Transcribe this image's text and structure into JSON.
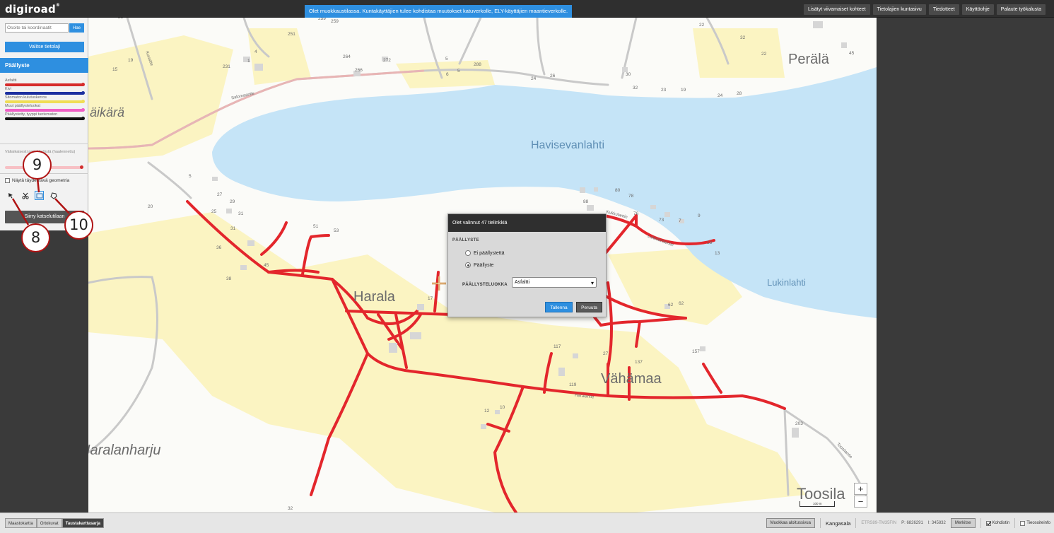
{
  "app": {
    "logo": "digiroad",
    "logo_mark": "®"
  },
  "notice": "Olet muokkaustilassa. Kuntakäyttäjien tulee kohdistaa muutokset katuverkolle, ELY-käyttäjien maantieverkolle.",
  "top_links": [
    "Lisätyt viivamaiset kohteet",
    "Tietolajien kuntasivu",
    "Tiedotteet",
    "Käyttöohje",
    "Palaute työkalusta"
  ],
  "sidebar": {
    "search_placeholder": "Osoite tai koordinaatit",
    "search_button": "Hae",
    "select_layer_button": "Valitse tietolaji",
    "layer_title": "Päällyste",
    "legend": [
      {
        "label": "Asfaltti",
        "color": "#d62b2b"
      },
      {
        "label": "Kivi",
        "color": "#1c2fa0"
      },
      {
        "label": "Sitomaton kulutuskerros",
        "color": "#f0dd55"
      },
      {
        "label": "Muut päällysteluokat",
        "color": "#ef5fc6"
      },
      {
        "label": "Päällystetty, tyyppi tuntematon",
        "color": "#111111"
      }
    ],
    "temporary_label": "Väliaikaisesti pois käytöstä (haalennettu)",
    "show_geometry_label": "Näytä täydentävä geometria",
    "view_mode_button": "Siirry katselutilaan"
  },
  "map_labels": {
    "perala": "Perälä",
    "havisevanlahti": "Havisevanlahti",
    "harala": "Harala",
    "lukinlahti": "Lukinlahti",
    "vahamaa": "Vähämaa",
    "haralanharju": "Haralanharju",
    "toosila": "Toosila",
    "aikara": "äikärä",
    "salomaantie": "Salomaantie",
    "kukkulantie": "Kukkulantie",
    "lukinlahdentie": "Lukinlahdentie",
    "toosilantie": "Toosilantie",
    "haralantie": "Haralantie",
    "kuusitie": "Kuusitie"
  },
  "house_numbers": [
    "23",
    "19",
    "15",
    "231",
    "1",
    "4",
    "251",
    "259",
    "259",
    "264",
    "266",
    "272",
    "288",
    "6",
    "5",
    "5",
    "22",
    "24",
    "26",
    "30",
    "32",
    "23",
    "19",
    "24",
    "28",
    "22",
    "32",
    "45",
    "80",
    "78",
    "88",
    "76",
    "73",
    "7",
    "9",
    "13",
    "13",
    "62",
    "62",
    "117",
    "27",
    "137",
    "157",
    "119",
    "12",
    "10",
    "5",
    "27",
    "29",
    "25",
    "31",
    "31",
    "36",
    "45",
    "38",
    "20",
    "51",
    "53",
    "17",
    "203",
    "32",
    "32"
  ],
  "dialog": {
    "title": "Olet valinnut 47 tielinkkiä",
    "section": "PÄÄLLYSTE",
    "options": [
      "Ei päällystettä",
      "Päällyste"
    ],
    "selected_option": "Päällyste",
    "class_label": "PÄÄLLYSTELUOKKA",
    "class_value": "Asfaltti",
    "save_button": "Tallenna",
    "cancel_button": "Peruuta"
  },
  "zoom": {
    "in": "+",
    "out": "−"
  },
  "scale_label": "100 m",
  "bottom": {
    "base_tabs": [
      "Maastokartta",
      "Ortokuvat",
      "Taustakarttasarja"
    ],
    "active_tab": "Taustakarttasarja",
    "edit_start_button": "Muokkaa aloitussivua",
    "municipality": "Kangasala",
    "crs": "ETRS89-TM35FIN",
    "coord_p": "P: 6826291",
    "coord_i": "I: 345832",
    "mark_button": "Merkitse",
    "crosshair_label": "Kohdistin",
    "roadinfo_label": "Tieosoiteinfo",
    "crosshair_checked": true,
    "roadinfo_checked": false
  },
  "callouts": [
    "9",
    "8",
    "10"
  ]
}
